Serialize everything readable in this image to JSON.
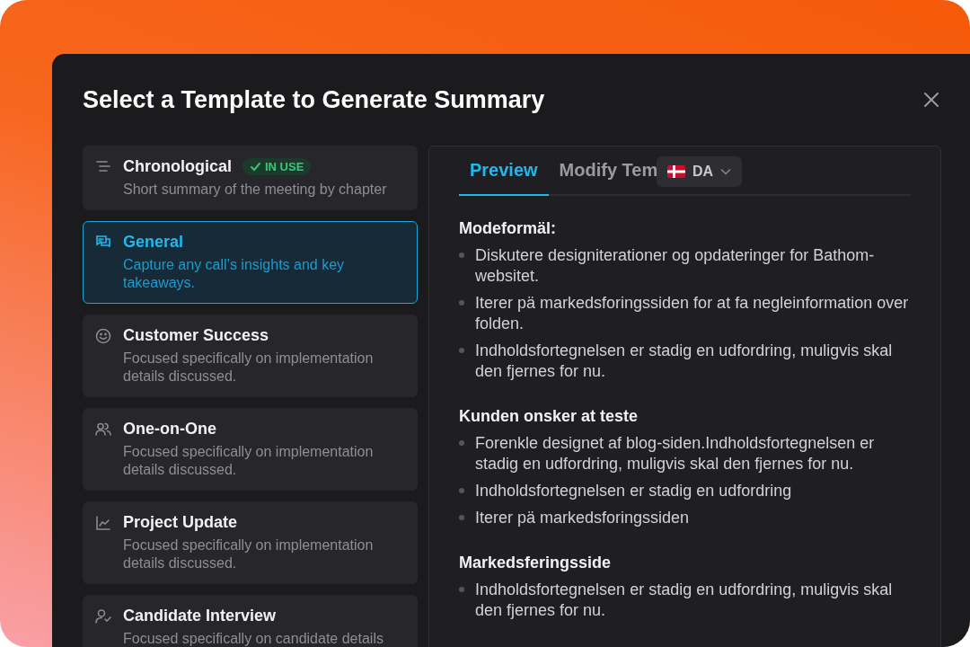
{
  "dialog": {
    "title": "Select a Template to Generate Summary"
  },
  "templates": [
    {
      "title": "Chronological",
      "badge": "IN USE",
      "description": "Short summary of the meeting by chapter",
      "selected": false
    },
    {
      "title": "General",
      "description": "Capture any call’s insights and key takeaways.",
      "selected": true
    },
    {
      "title": "Customer Success",
      "description": "Focused specifically on implementation details discussed.",
      "selected": false
    },
    {
      "title": "One-on-One",
      "description": "Focused specifically on implementation details discussed.",
      "selected": false
    },
    {
      "title": "Project Update",
      "description": "Focused specifically on implementation details discussed.",
      "selected": false
    },
    {
      "title": "Candidate Interview",
      "description": "Focused specifically on candidate details",
      "selected": false
    }
  ],
  "tabs": [
    {
      "label": "Preview",
      "selected": true
    },
    {
      "label": "Modify Tem",
      "selected": false
    }
  ],
  "language": {
    "value": "DA"
  },
  "sections": [
    {
      "heading": "Modeformäl:",
      "bullets": [
        "Diskutere designiterationer og opdateringer for Bathom-websitet.",
        "Iterer pä markedsforingssiden for at fa negleinformation over folden.",
        "Indholdsfortegnelsen er stadig en udfordring, muligvis skal den fjernes for nu."
      ]
    },
    {
      "heading": "Kunden onsker at teste",
      "bullets": [
        "Forenkle designet af blog-siden.Indholdsfortegnelsen er stadig en udfordring, muligvis skal den fjernes for nu.",
        "Indholdsfortegnelsen er stadig en udfordring",
        "Iterer pä markedsforingssiden"
      ]
    },
    {
      "heading": "Markedsferingsside",
      "bullets": [
        "Indholdsfortegnelsen er stadig en udfordring, muligvis skal den fjernes for nu."
      ]
    }
  ]
}
